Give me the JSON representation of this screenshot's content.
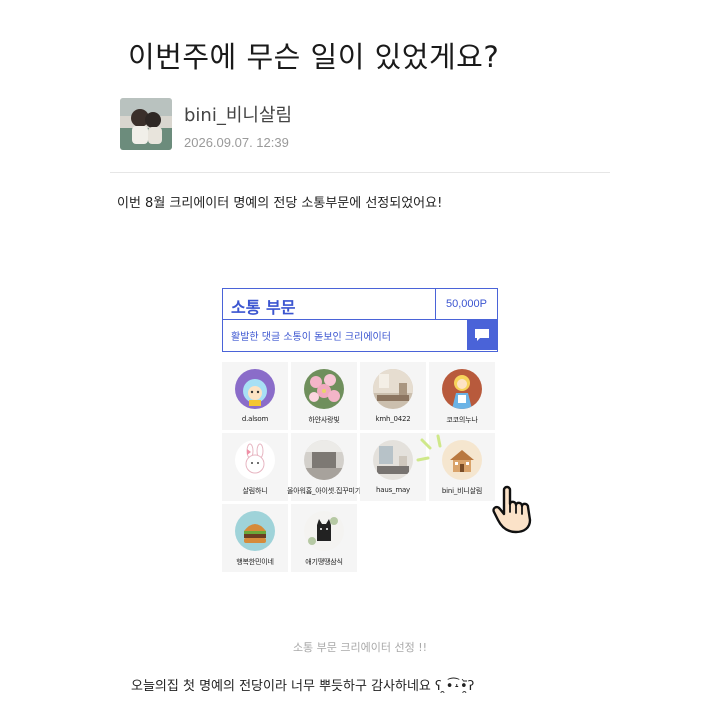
{
  "post": {
    "title": "이번주에 무슨 일이 있었게요?",
    "author_name": "bini_비니살림",
    "date": "2026.09.07. 12:39",
    "intro_text": "이번 8월 크리에이터 명예의 전당 소통부문에 선정되었어요!",
    "caption": "소통 부문 크리에이터 선정 !!",
    "closing_text": "오늘의집 첫 명예의 전당이라 너무 뿌듯하구 감사하네요 ʕ ̯•͡˔•̯᷅ʔ"
  },
  "award": {
    "category": "소통 부문",
    "points": "50,000P",
    "description": "활발한 댓글 소통이 돋보인 크리에이터",
    "accent_color": "#4a63d8"
  },
  "creators": [
    {
      "name": "d.alsom",
      "icon": "cartoon-avatar-icon"
    },
    {
      "name": "하얀사랑빛",
      "icon": "flower-avatar-icon"
    },
    {
      "name": "kmh_0422",
      "icon": "room-avatar-icon"
    },
    {
      "name": "코코의누나",
      "icon": "alice-avatar-icon"
    },
    {
      "name": "살림하니",
      "icon": "bunny-avatar-icon"
    },
    {
      "name": "올아워홈_아이셋.집꾸미기",
      "icon": "interior-avatar-icon"
    },
    {
      "name": "haus_may",
      "icon": "living-room-avatar-icon"
    },
    {
      "name": "bini_비니살림",
      "icon": "house-avatar-icon",
      "highlighted": true
    },
    {
      "name": "행복한민이네",
      "icon": "burger-avatar-icon"
    },
    {
      "name": "애기땡땡삼식",
      "icon": "cat-avatar-icon"
    }
  ]
}
